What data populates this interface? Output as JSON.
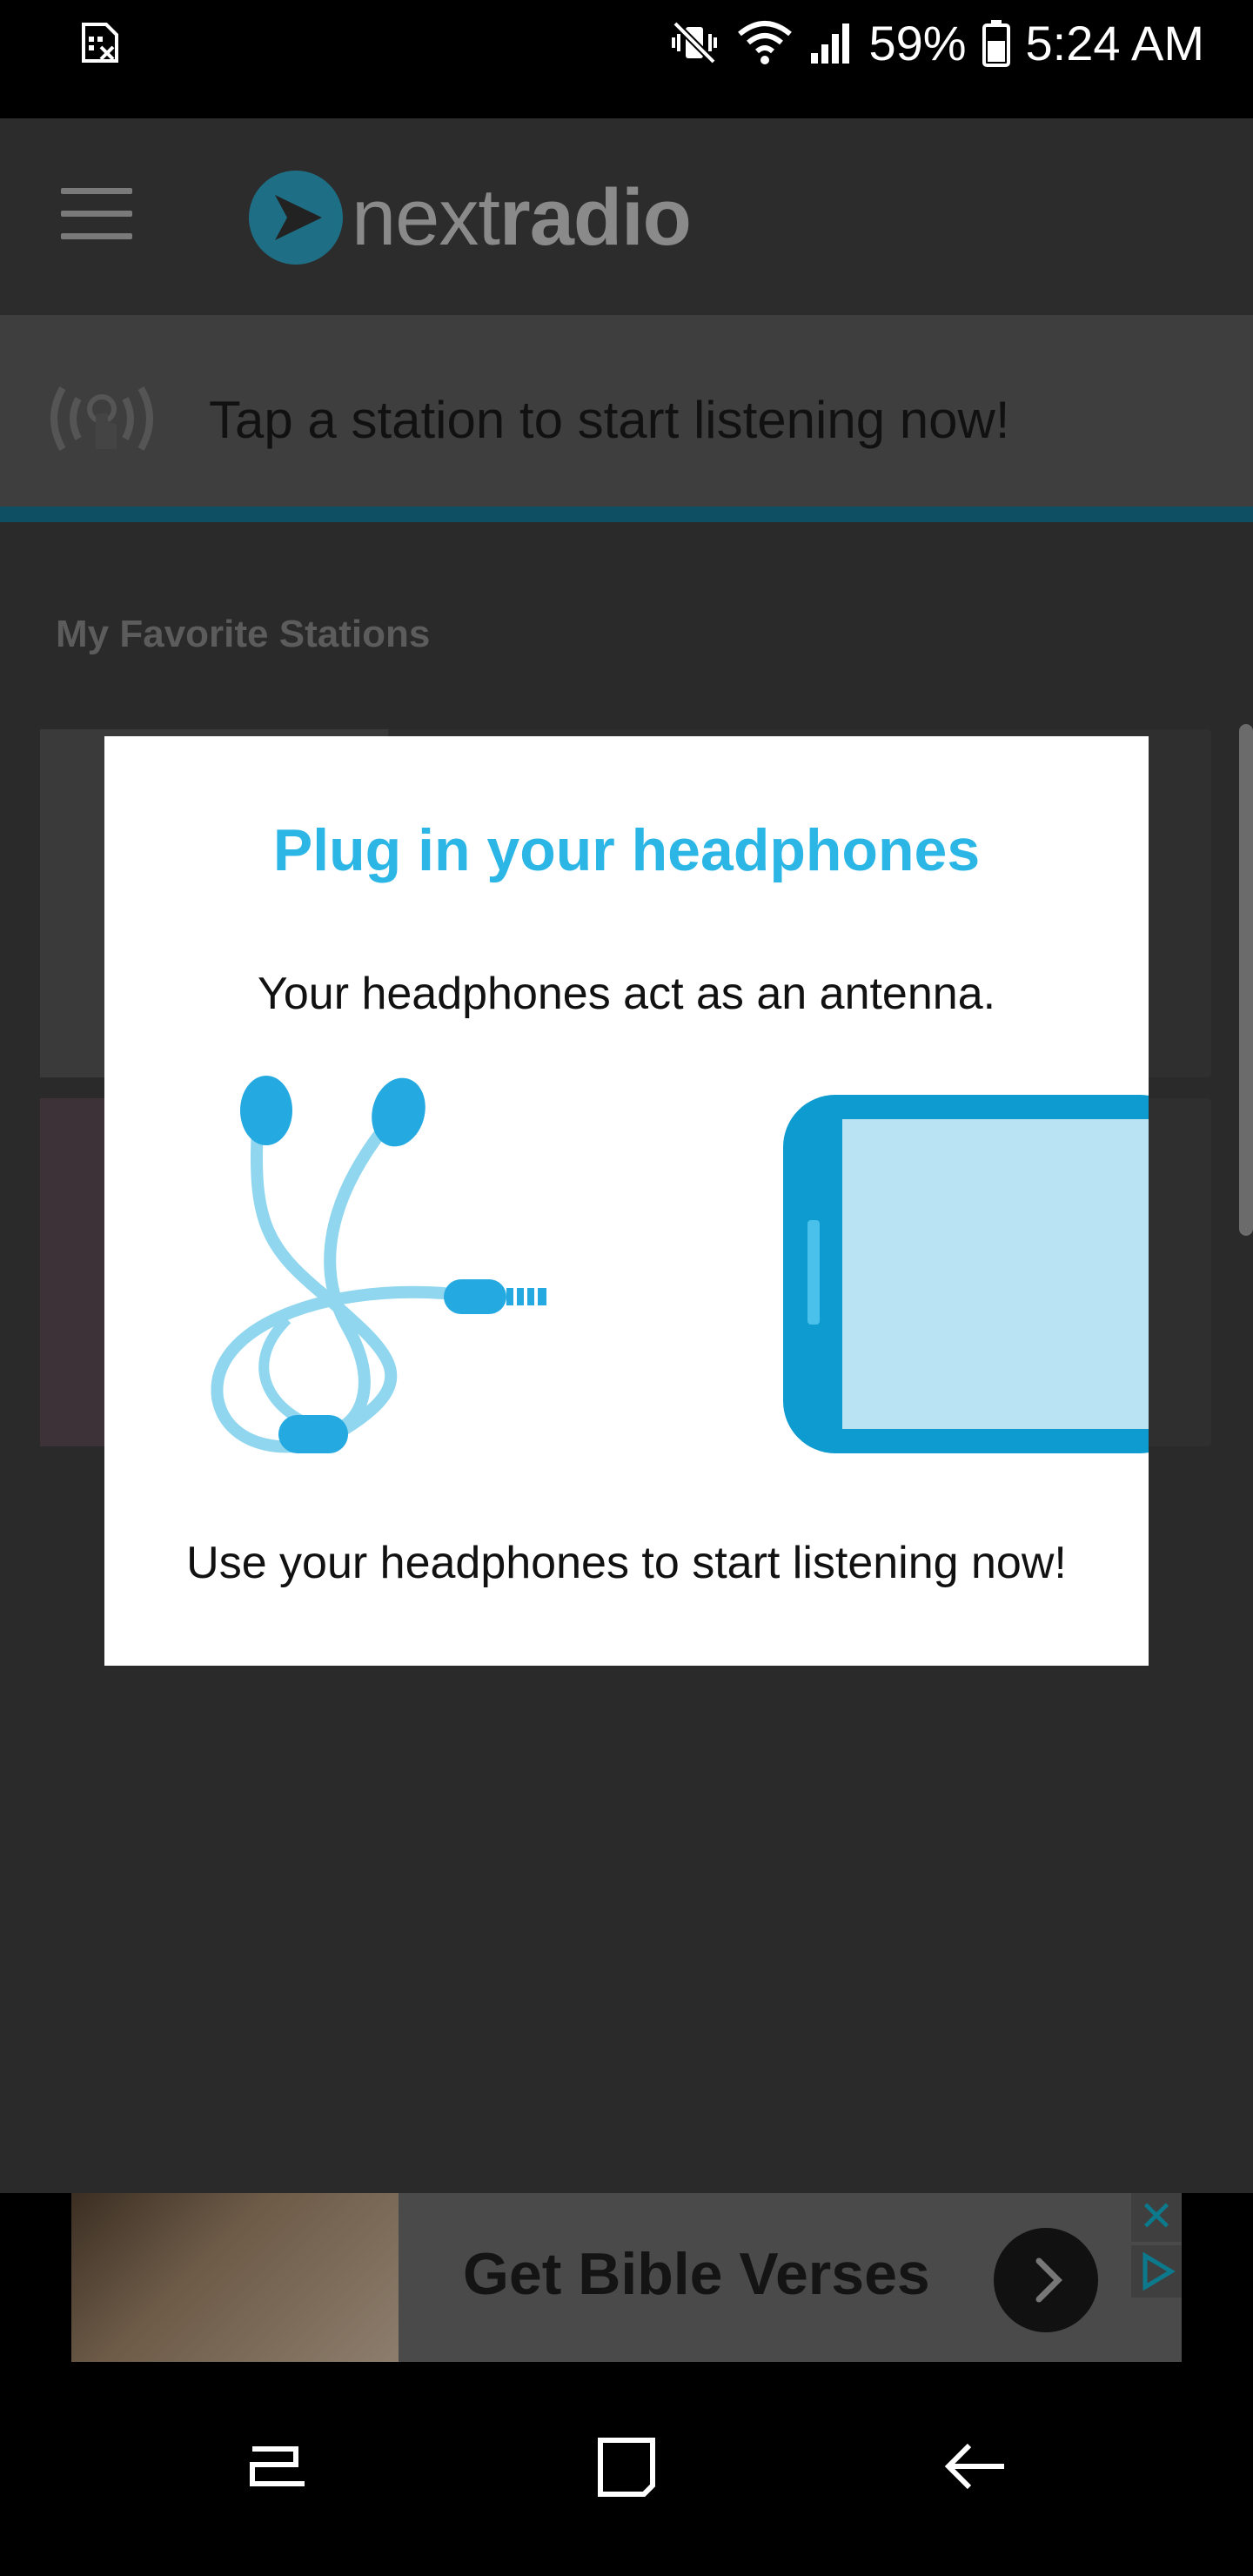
{
  "status_bar": {
    "battery": "59%",
    "time": "5:24 AM"
  },
  "app": {
    "logo_prefix": "next",
    "logo_suffix": "radio",
    "tap_banner_text": "Tap a station to start listening now!",
    "favorites_title": "My Favorite Stations"
  },
  "dialog": {
    "title": "Plug in your headphones",
    "subtitle": "Your headphones act as an antenna.",
    "footer": "Use your headphones to start listening now!"
  },
  "ad": {
    "text": "Get Bible Verses",
    "close_label": "✕"
  },
  "colors": {
    "accent": "#2bb6e5",
    "phone_dark": "#0e9bd0",
    "phone_screen": "#b9e3f2",
    "earbud_wire": "#8fd6ee",
    "earbud": "#24a9e1"
  }
}
